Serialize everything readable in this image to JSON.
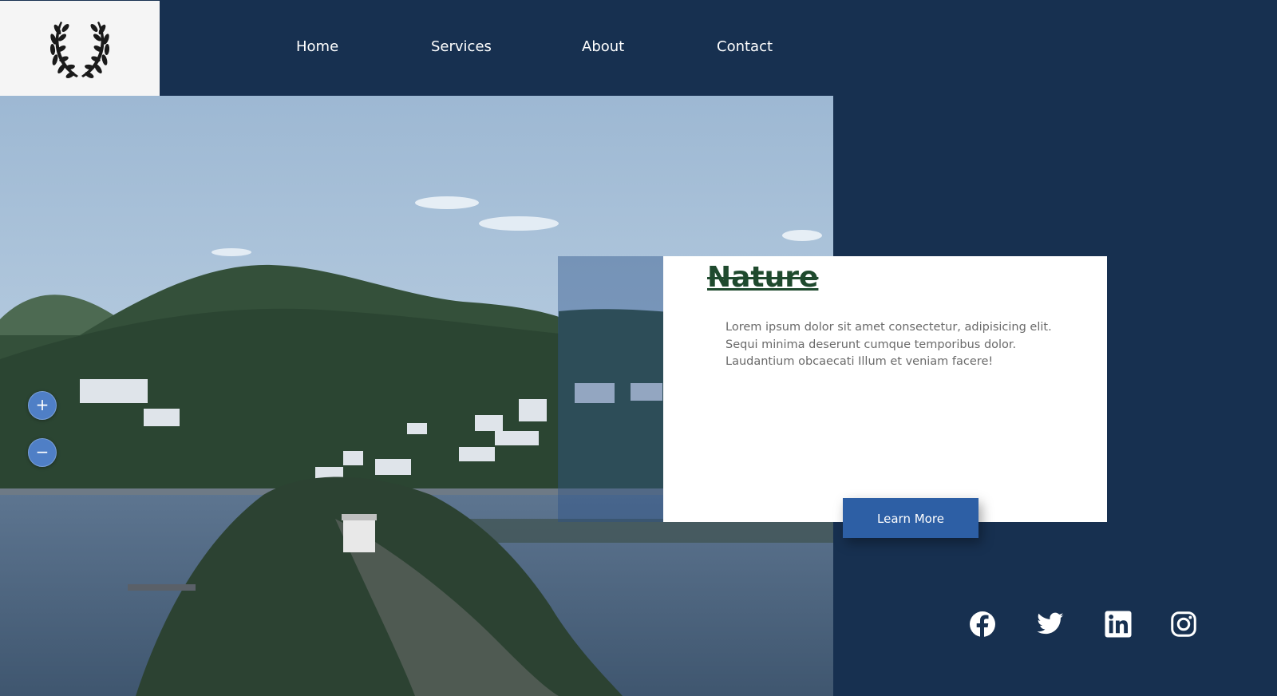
{
  "nav": {
    "items": [
      {
        "label": "Home"
      },
      {
        "label": "Services"
      },
      {
        "label": "About"
      },
      {
        "label": "Contact"
      }
    ]
  },
  "logo": {
    "icon": "laurel-wreath-icon"
  },
  "zoom": {
    "in_label": "+",
    "out_label": "−"
  },
  "card": {
    "title": "Nature",
    "body": "Lorem ipsum dolor sit amet consectetur, adipisicing elit. Sequi minima deserunt cumque temporibus dolor. Laudantium obcaecati Illum et veniam facere!",
    "button_label": "Learn More"
  },
  "social": [
    {
      "icon": "facebook-icon"
    },
    {
      "icon": "twitter-icon"
    },
    {
      "icon": "linkedin-icon"
    },
    {
      "icon": "instagram-icon"
    }
  ],
  "colors": {
    "background": "#173050",
    "accent": "#2d5fa5",
    "title": "#1f4a2e"
  }
}
